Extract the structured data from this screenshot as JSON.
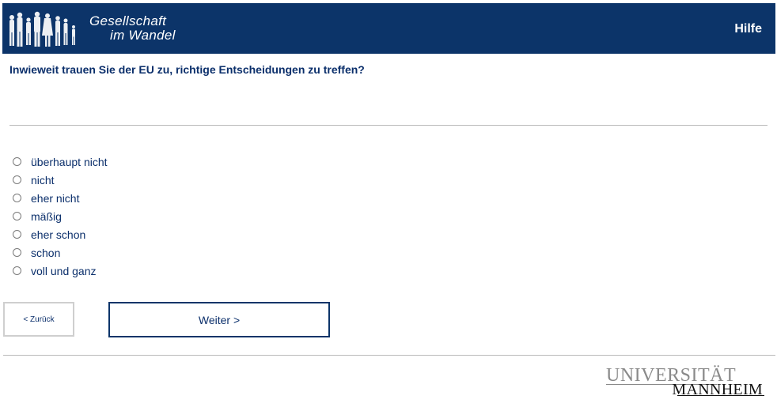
{
  "header": {
    "logo_line1": "Gesellschaft",
    "logo_line2": "im Wandel",
    "help_label": "Hilfe",
    "background_color": "#0c3469"
  },
  "question": {
    "text": "Inwieweit trauen Sie der EU zu, richtige Entscheidungen zu treffen?"
  },
  "options": [
    {
      "label": "überhaupt nicht"
    },
    {
      "label": "nicht"
    },
    {
      "label": "eher nicht"
    },
    {
      "label": "mäßig"
    },
    {
      "label": "eher schon"
    },
    {
      "label": "schon"
    },
    {
      "label": "voll und ganz"
    }
  ],
  "navigation": {
    "back_label": "< Zurück",
    "next_label": "Weiter >"
  },
  "footer": {
    "university_line1": "UNIVERSITÄT",
    "university_line2": "MANNHEIM"
  }
}
